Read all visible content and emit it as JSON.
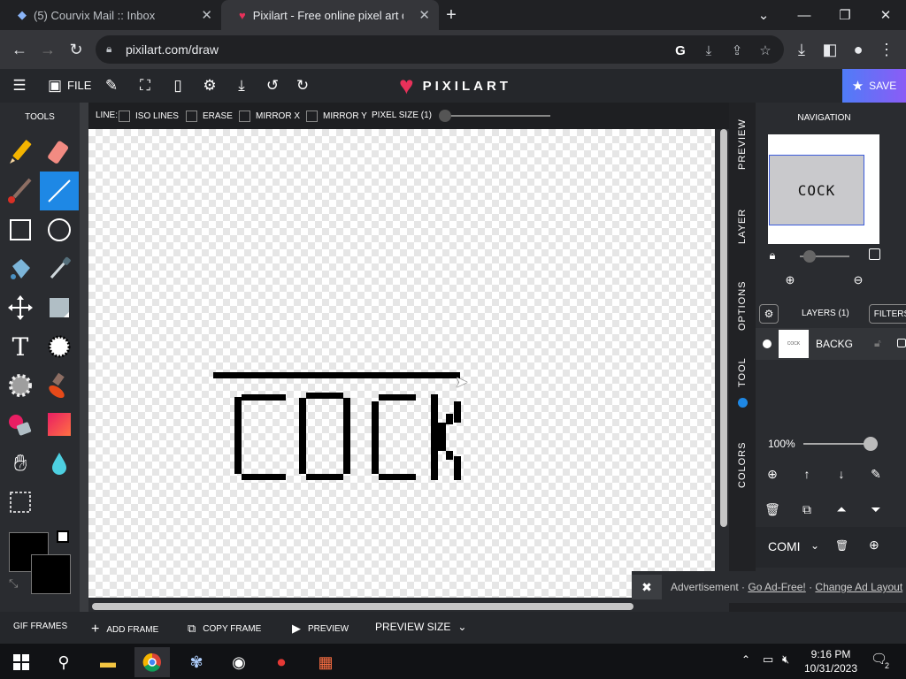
{
  "browser": {
    "tabs": [
      {
        "title": "(5) Courvix Mail :: Inbox",
        "active": false
      },
      {
        "title": "Pixilart - Free online pixel art drawing tool",
        "active": true
      }
    ],
    "new_tab": "+",
    "url": "pixilart.com/draw"
  },
  "header": {
    "file_label": "FILE",
    "brand": "PIXILART",
    "save_label": "SAVE"
  },
  "tools": {
    "title": "TOOLS"
  },
  "line_options": {
    "label": "LINE:",
    "iso_lines": "ISO LINES",
    "erase": "ERASE",
    "mirror_x": "MIRROR X",
    "mirror_y": "MIRROR Y",
    "pixel_size": "PIXEL SIZE (1)"
  },
  "canvas": {
    "drawn_text": "COCK"
  },
  "right_panel": {
    "tabs": [
      "PREVIEW",
      "LAYER",
      "OPTIONS",
      "TOOL",
      "COLORS"
    ],
    "navigation_title": "NAVIGATION",
    "preview_text": "COCK",
    "layers_title": "LAYERS (1)",
    "filters_label": "FILTERS",
    "layer_name": "BACKG",
    "opacity": "100%",
    "combo_label": "COMI"
  },
  "ad": {
    "text": "Advertisement · ",
    "go_ad_free": "Go Ad-Free!",
    "separator": " · ",
    "change_layout": "Change Ad Layout"
  },
  "frames_bar": {
    "gif_frames": "GIF FRAMES",
    "add_frame": "ADD FRAME",
    "copy_frame": "COPY FRAME",
    "preview": "PREVIEW",
    "preview_size": "PREVIEW SIZE"
  },
  "taskbar": {
    "time": "9:16 PM",
    "date": "10/31/2023",
    "notifications": "2"
  },
  "colors": {
    "accent": "#1e88e5",
    "brand_heart": "#e8315a",
    "primary_color": "#000000",
    "secondary_color": "#000000"
  }
}
